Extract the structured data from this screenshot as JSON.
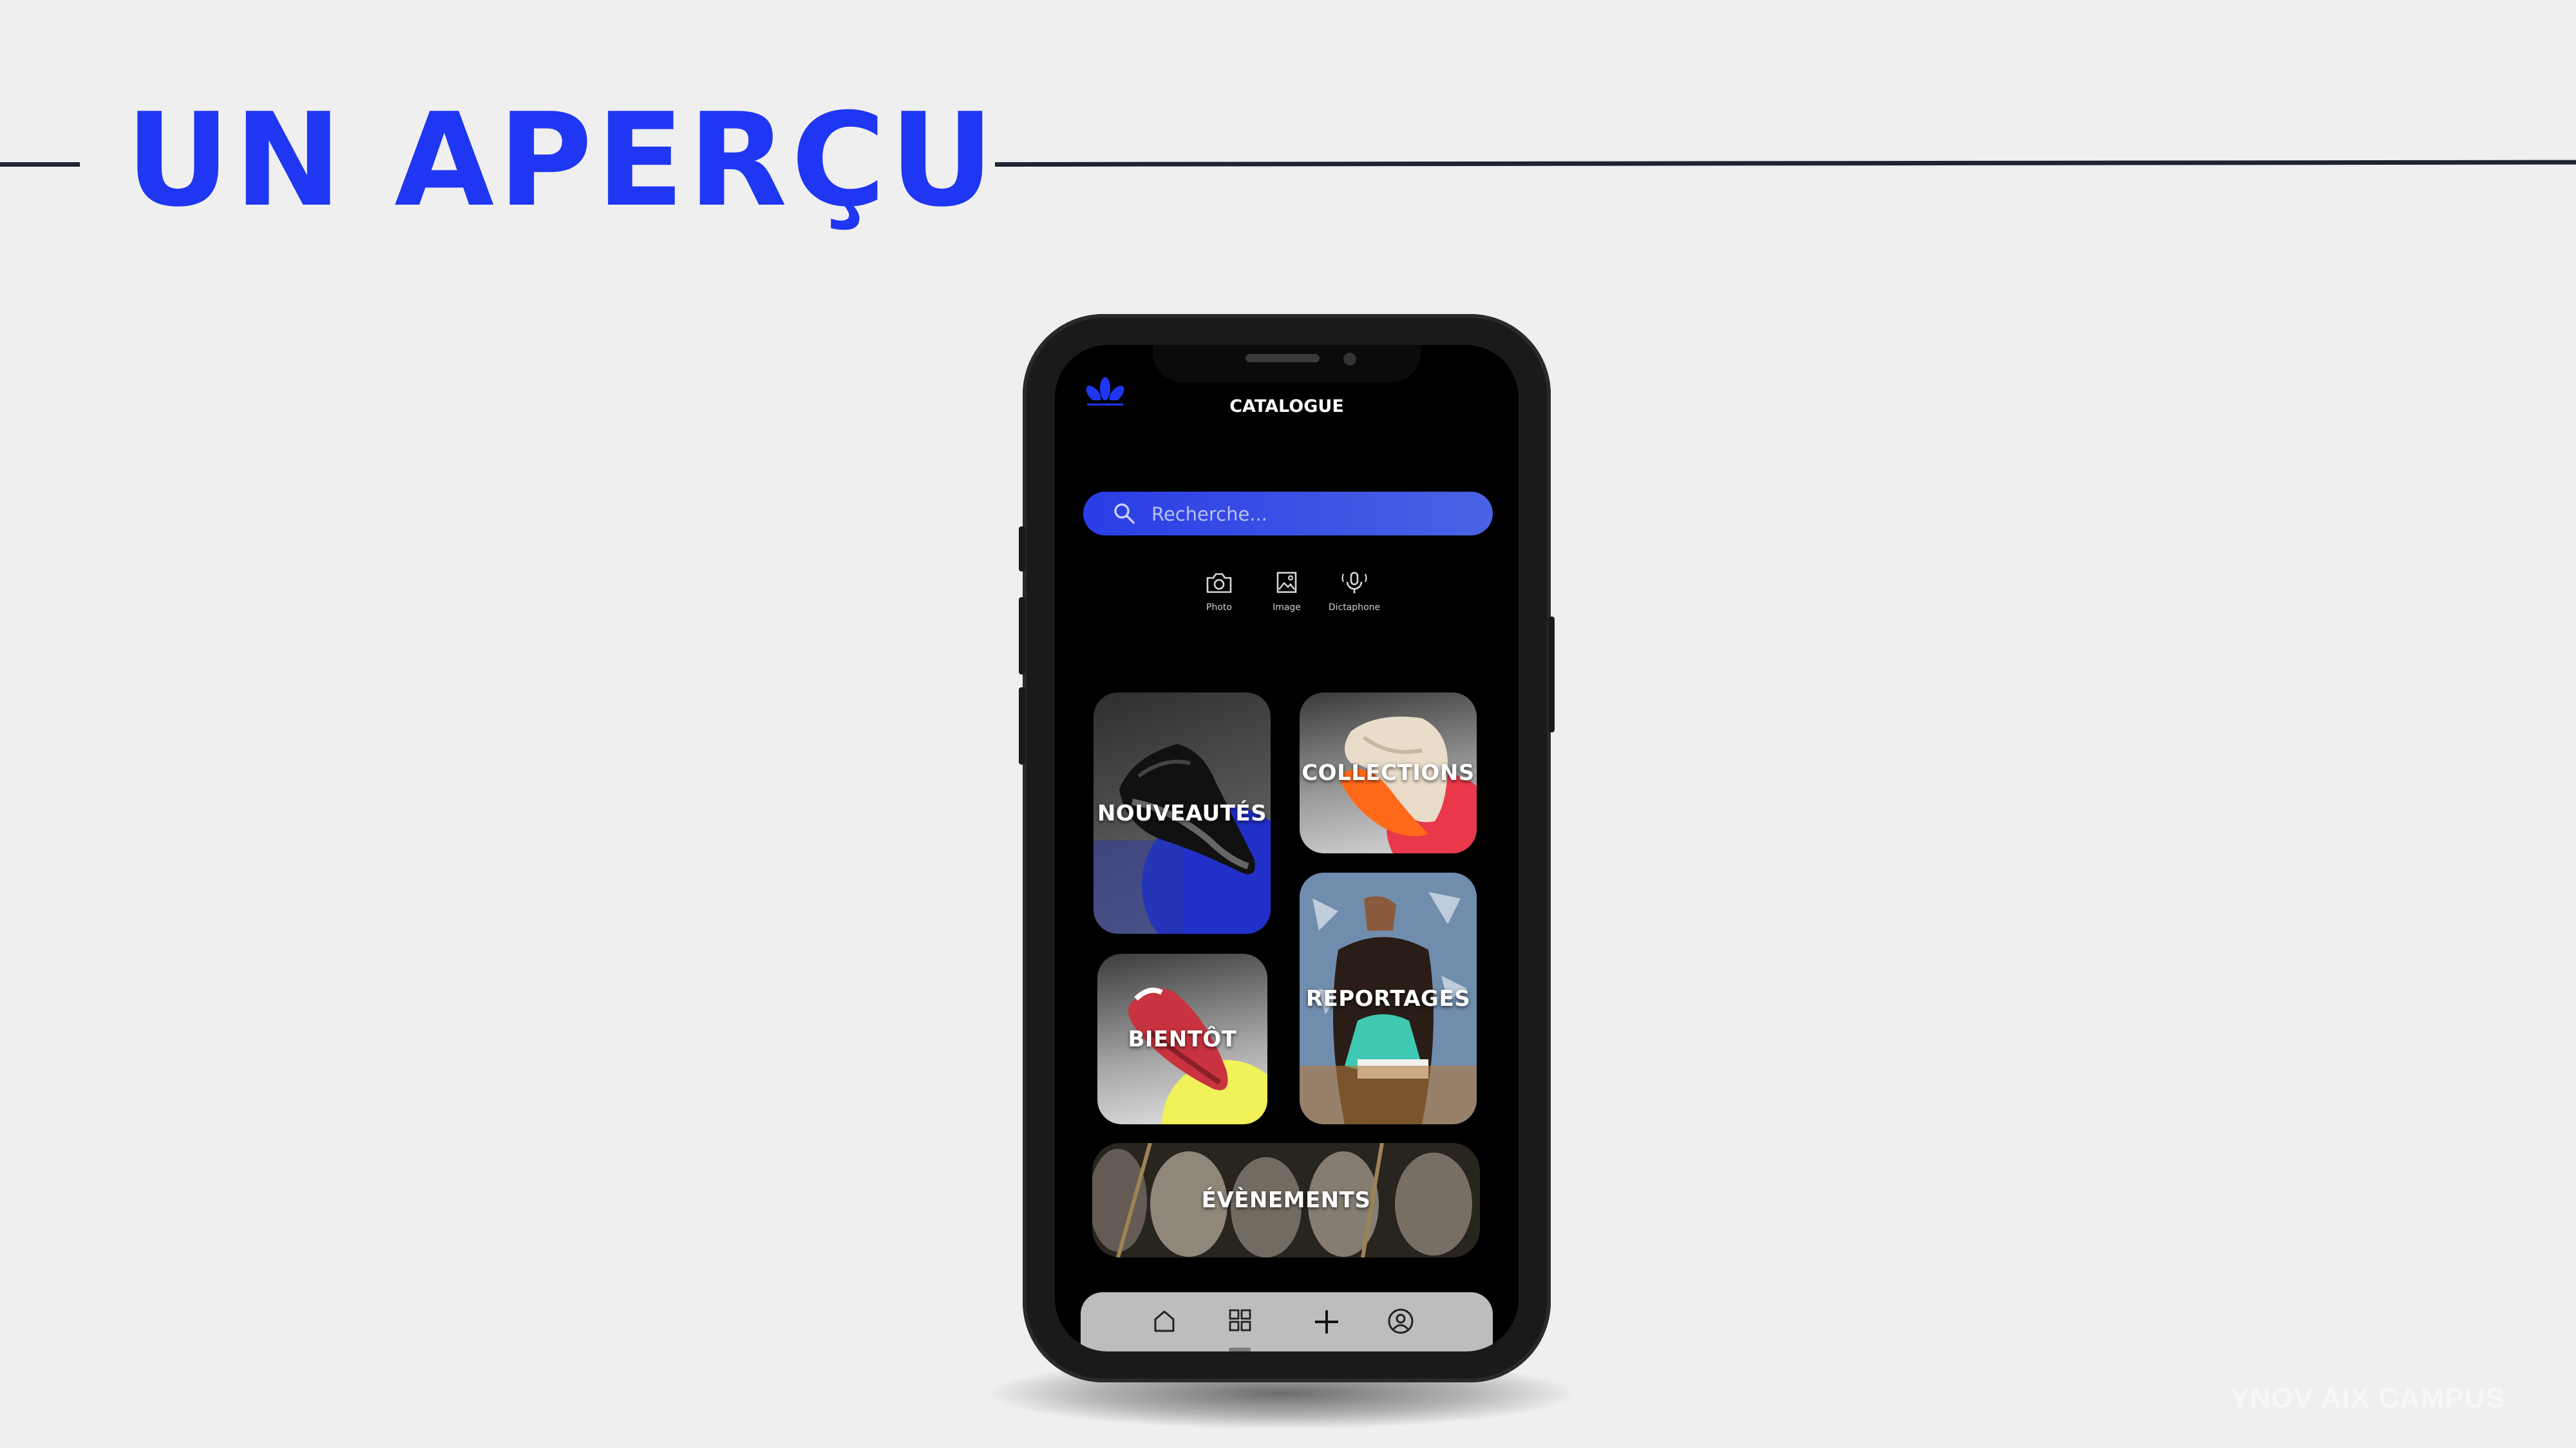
{
  "slide": {
    "title": "UN APERÇU",
    "footer": "YNOV AIX CAMPUS"
  },
  "app": {
    "title": "CATALOGUE",
    "logo_icon": "adidas-trefoil-icon",
    "accent_color": "#1f36f2",
    "search": {
      "placeholder": "Recherche...",
      "icon": "search-icon"
    },
    "tools": [
      {
        "label": "Photo",
        "icon": "camera-icon"
      },
      {
        "label": "Image",
        "icon": "image-icon"
      },
      {
        "label": "Dictaphone",
        "icon": "microphone-icon"
      }
    ],
    "categories": {
      "new": "NOUVEAUTÉS",
      "collections": "COLLECTIONS",
      "soon": "BIENTÔT",
      "reports": "REPORTAGES",
      "events": "ÉVÈNEMENTS"
    },
    "bottom_nav": [
      {
        "icon": "home-icon"
      },
      {
        "icon": "grid-icon",
        "active": true
      },
      {
        "icon": "plus-icon"
      },
      {
        "icon": "profile-icon"
      }
    ]
  }
}
